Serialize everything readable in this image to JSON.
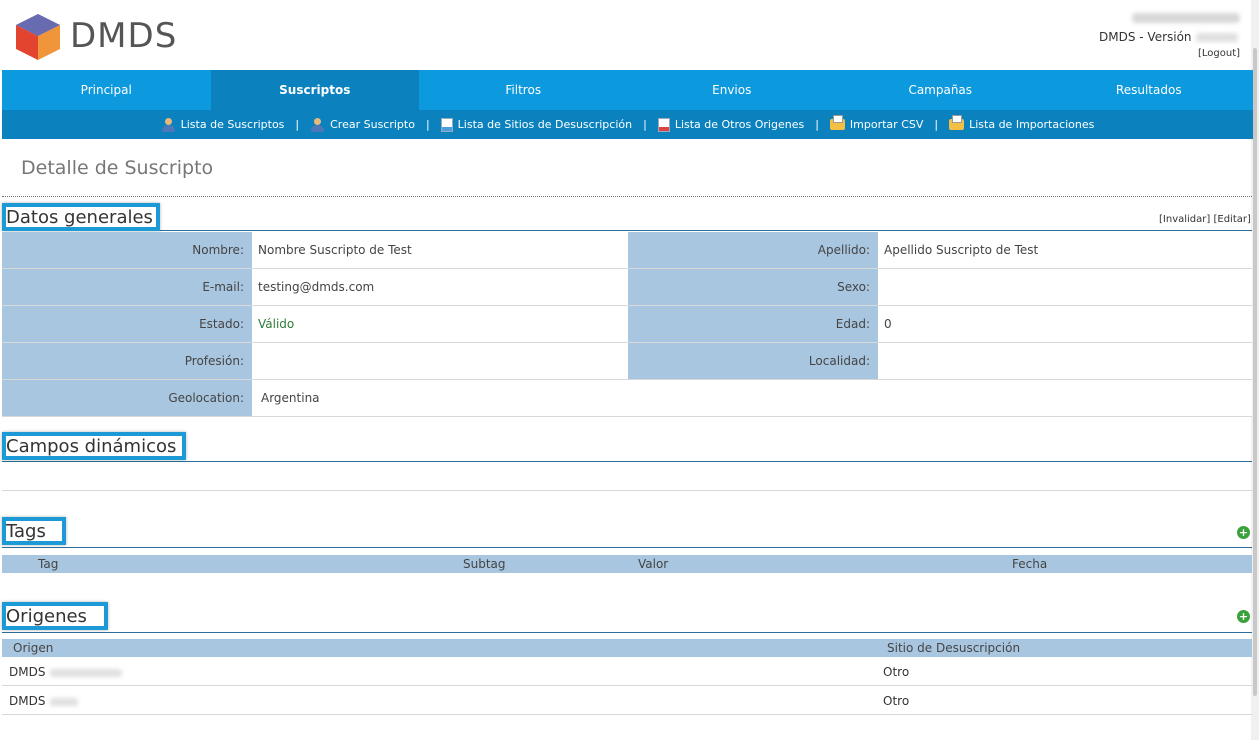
{
  "header": {
    "logo_text": "DMDS",
    "version_label": "DMDS - Versión",
    "logout": "[Logout]"
  },
  "nav": {
    "items": [
      "Principal",
      "Suscriptos",
      "Filtros",
      "Envios",
      "Campañas",
      "Resultados"
    ],
    "active": "Suscriptos"
  },
  "subnav": {
    "items": [
      {
        "label": "Lista de Suscriptos",
        "icon": "user-icon"
      },
      {
        "label": "Crear Suscripto",
        "icon": "user-add-icon"
      },
      {
        "label": "Lista de Sitios de Desuscripción",
        "icon": "document-icon"
      },
      {
        "label": "Lista de Otros Origenes",
        "icon": "document-red-icon"
      },
      {
        "label": "Importar CSV",
        "icon": "folder-import-icon"
      },
      {
        "label": "Lista de Importaciones",
        "icon": "folder-list-icon"
      }
    ],
    "separator": "|"
  },
  "page": {
    "title": "Detalle de Suscripto"
  },
  "datos": {
    "title": "Datos generales",
    "invalidar": "[Invalidar]",
    "editar": "[Editar]",
    "fields": {
      "nombre_label": "Nombre:",
      "nombre": "Nombre Suscripto de Test",
      "apellido_label": "Apellido:",
      "apellido": "Apellido Suscripto de Test",
      "email_label": "E-mail:",
      "email": "testing@dmds.com",
      "sexo_label": "Sexo:",
      "sexo": "",
      "estado_label": "Estado:",
      "estado": "Válido",
      "edad_label": "Edad:",
      "edad": "0",
      "profesion_label": "Profesión:",
      "profesion": "",
      "localidad_label": "Localidad:",
      "localidad": "",
      "geolocation_label": "Geolocation:",
      "geolocation": "Argentina"
    }
  },
  "campos": {
    "title": "Campos dinámicos"
  },
  "tags": {
    "title": "Tags",
    "columns": [
      "Tag",
      "Subtag",
      "Valor",
      "Fecha"
    ]
  },
  "origenes": {
    "title": "Origenes",
    "columns": [
      "Origen",
      "Sitio de Desuscripción"
    ],
    "rows": [
      {
        "origen": "DMDS",
        "sitio": "Otro"
      },
      {
        "origen": "DMDS",
        "sitio": "Otro"
      }
    ]
  },
  "colors": {
    "nav": "#0c99de",
    "nav_active": "#0b82be",
    "label_bg": "#a9c6e0",
    "highlight": "#1c9ad6",
    "valid": "#2d7d3a"
  }
}
